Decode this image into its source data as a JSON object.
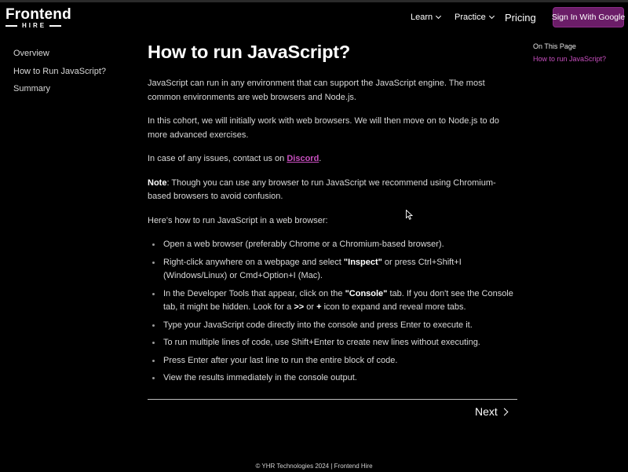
{
  "header": {
    "logo_top": "Frontend",
    "logo_bottom": "HIRE",
    "nav": [
      {
        "label": "Learn"
      },
      {
        "label": "Practice"
      },
      {
        "label": "Pricing"
      }
    ],
    "signin_label": "Sign In With Google",
    "accent_color": "#6b1d68"
  },
  "sidebar": {
    "items": [
      "Overview",
      "How to Run JavaScript?",
      "Summary"
    ]
  },
  "toc": {
    "title": "On This Page",
    "link": "How to run JavaScript?",
    "link_color": "#c84fbf"
  },
  "main": {
    "title": "How to run JavaScript?",
    "p1": "JavaScript can run in any environment that can support the JavaScript engine. The most common environments are web browsers and Node.js.",
    "p2": "In this cohort, we will initially work with web browsers. We will then move on to Node.js to do more advanced exercises.",
    "p3_prefix": "In case of any issues, contact us on ",
    "p3_link": "Discord",
    "p3_suffix": ".",
    "note_label": "Note",
    "note_text": ": Though you can use any browser to run JavaScript we recommend using Chromium-based browsers to avoid confusion.",
    "intro": "Here's how to run JavaScript in a web browser:",
    "steps": {
      "s1": "Open a web browser (preferably Chrome or a Chromium-based browser).",
      "s2_a": "Right-click anywhere on a webpage and select ",
      "s2_b": "\"Inspect\"",
      "s2_c": " or press Ctrl+Shift+I (Windows/Linux) or Cmd+Option+I (Mac).",
      "s3_a": "In the Developer Tools that appear, click on the ",
      "s3_b": "\"Console\"",
      "s3_c": " tab. If you don't see the Console tab, it might be hidden. Look for a ",
      "s3_d": ">>",
      "s3_e": " or ",
      "s3_f": "+",
      "s3_g": " icon to expand and reveal more tabs.",
      "s4": "Type your JavaScript code directly into the console and press Enter to execute it.",
      "s5": "To run multiple lines of code, use Shift+Enter to create new lines without executing.",
      "s6": "Press Enter after your last line to run the entire block of code.",
      "s7": "View the results immediately in the console output."
    },
    "next_label": "Next"
  },
  "footer": {
    "text": "© YHR Technologies 2024 | Frontend Hire"
  }
}
